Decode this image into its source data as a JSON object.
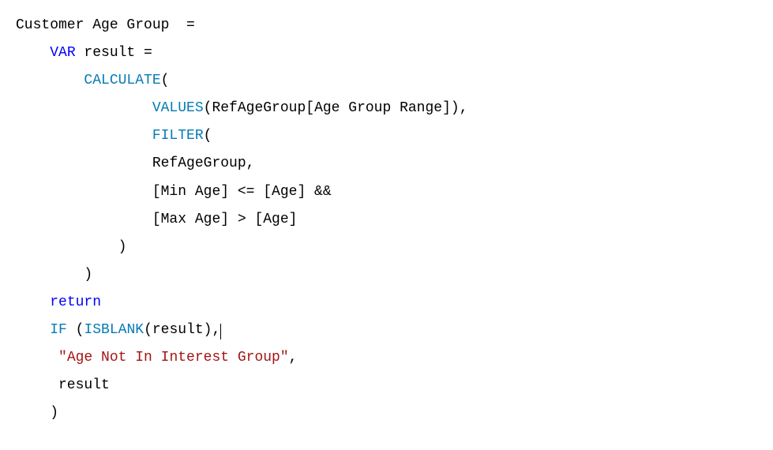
{
  "code": {
    "l1a": "Customer Age Group  =",
    "l2a": "    ",
    "l2b": "VAR",
    "l2c": " result =",
    "l3a": "        ",
    "l3b": "CALCULATE",
    "l3c": "(",
    "l4a": "                ",
    "l4b": "VALUES",
    "l4c": "(RefAgeGroup[Age Group Range]),",
    "l5a": "                ",
    "l5b": "FILTER",
    "l5c": "(",
    "l6a": "                RefAgeGroup,",
    "l7a": "                [Min Age] <= [Age] &&",
    "l8a": "                [Max Age] > [Age]",
    "l9a": "            )",
    "l10a": "        )",
    "l11a": "    ",
    "l11b": "return",
    "l12a": "    ",
    "l12b": "IF",
    "l12c": " (",
    "l12d": "ISBLANK",
    "l12e": "(result),",
    "l13a": "     ",
    "l13b": "\"Age Not In Interest Group\"",
    "l13c": ",",
    "l14a": "     result",
    "l15a": "    )"
  }
}
